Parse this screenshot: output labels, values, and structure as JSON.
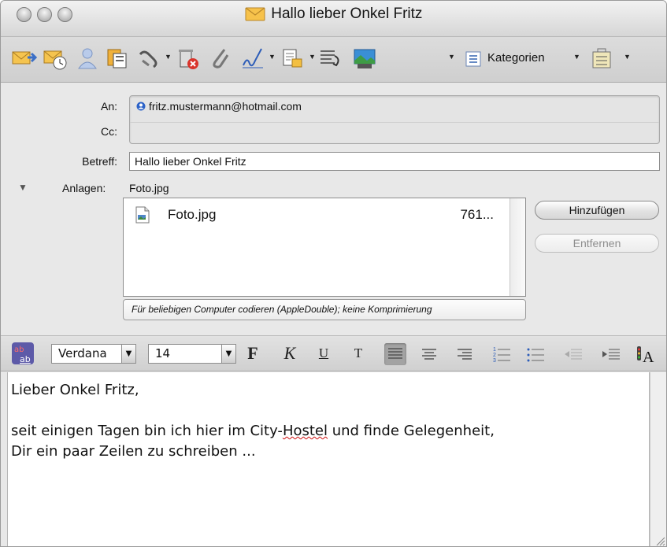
{
  "window": {
    "title": "Hallo lieber Onkel Fritz"
  },
  "toolbar": {
    "buttons": [
      {
        "icon": "send-icon"
      },
      {
        "icon": "send-later-icon"
      },
      {
        "icon": "address-book-icon"
      },
      {
        "icon": "copy-icon"
      },
      {
        "icon": "link-icon"
      },
      {
        "icon": "delete-icon"
      },
      {
        "icon": "attach-icon"
      },
      {
        "icon": "signature-icon"
      },
      {
        "icon": "options-icon"
      },
      {
        "icon": "format-icon"
      },
      {
        "icon": "photo-icon"
      },
      {
        "icon": "categories-icon"
      },
      {
        "icon": "project-icon"
      }
    ],
    "kategorien_label": "Kategorien"
  },
  "header": {
    "to_label": "An:",
    "cc_label": "Cc:",
    "to_value": "fritz.mustermann@hotmail.com",
    "subject_label": "Betreff:",
    "subject_value": "Hallo lieber Onkel Fritz",
    "attachments_label": "Anlagen:",
    "attachments_summary": "Foto.jpg",
    "attachments": [
      {
        "name": "Foto.jpg",
        "size": "761..."
      }
    ],
    "add_button": "Hinzufügen",
    "remove_button": "Entfernen",
    "encoding": "Für beliebigen Computer codieren (AppleDouble); keine Komprimierung"
  },
  "formatbar": {
    "font": "Verdana",
    "size": "14",
    "bold": "F",
    "italic": "K",
    "underline": "U",
    "text": "T",
    "alignment": "left"
  },
  "body": {
    "line1": "Lieber Onkel Fritz,",
    "line2_pre": "seit einigen Tagen bin ich hier im City-",
    "line2_misspelled": "Hostel",
    "line2_post": " und finde Gelegenheit,",
    "line3": "Dir ein paar Zeilen zu schreiben ..."
  },
  "colors": {
    "accent": "#5d5aa8",
    "window_bg": "#e8e8e8"
  }
}
